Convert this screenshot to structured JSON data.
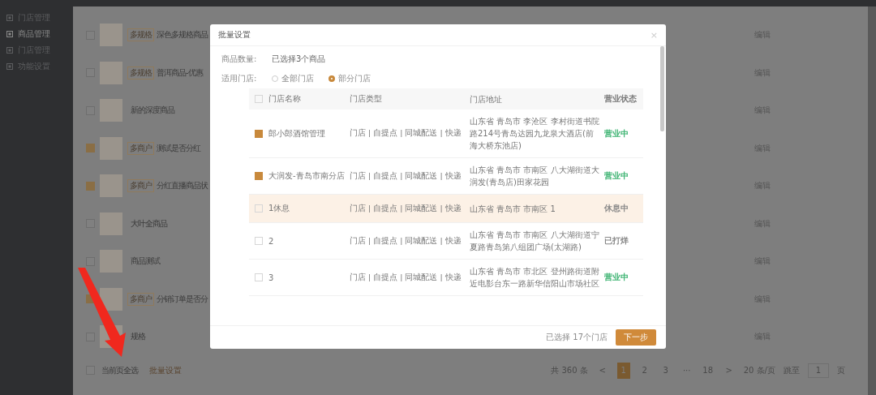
{
  "sidebar": {
    "items": [
      {
        "label": "门店管理",
        "selected": false
      },
      {
        "label": "商品管理",
        "selected": true
      },
      {
        "label": "门店管理",
        "selected": false
      },
      {
        "label": "功能设置",
        "selected": false
      }
    ]
  },
  "products": {
    "rows": [
      {
        "checked": false,
        "tag": "多规格",
        "name": "深色多规格商品",
        "action": "编辑"
      },
      {
        "checked": false,
        "tag": "多规格",
        "name": "普洱商品-优惠",
        "action": "编辑"
      },
      {
        "checked": false,
        "name": "新的深度商品",
        "action": "编辑"
      },
      {
        "checked": true,
        "tag": "多商户",
        "name": "测试是否分红",
        "action": "编辑"
      },
      {
        "checked": true,
        "tag": "多商户",
        "name": "分红直播商品状",
        "action": "编辑"
      },
      {
        "checked": false,
        "name": "大叶全商品",
        "action": "编辑"
      },
      {
        "checked": false,
        "name": "商品测试",
        "action": "编辑"
      },
      {
        "checked": true,
        "tag": "多商户",
        "name": "分销订单是否分",
        "action": "编辑"
      },
      {
        "checked": false,
        "name": "规格",
        "action": "编辑"
      }
    ],
    "select_all": {
      "label": "当前页全选",
      "checked": false
    },
    "batch_link": "批量设置",
    "pagination": {
      "total": "共 360 条",
      "prev": "<",
      "pages": [
        {
          "label": "1",
          "selected": true
        },
        {
          "label": "2",
          "selected": false
        },
        {
          "label": "3",
          "selected": false
        },
        {
          "label": "···",
          "selected": false
        },
        {
          "label": "18",
          "selected": false
        }
      ],
      "next": ">",
      "page_size": "20 条/页",
      "jump_label": "跳至",
      "jump_value": "1",
      "page_unit": "页"
    }
  },
  "modal": {
    "title": "批量设置",
    "close": "×",
    "count_label": "商品数量:",
    "count_value": "已选择3个商品",
    "stores_label": "适用门店:",
    "radios": [
      {
        "label": "全部门店",
        "selected": false
      },
      {
        "label": "部分门店",
        "selected": true
      }
    ],
    "table": {
      "header_checked": false,
      "columns": [
        "门店名称",
        "门店类型",
        "门店地址",
        "营业状态"
      ],
      "rows": [
        {
          "checked": true,
          "highlighted": false,
          "name": "郎小郎酒馆管理",
          "type": "门店 | 自提点 | 同城配送 | 快递",
          "address": "山东省 青岛市 李沧区 李村街道书院路214号青岛达园九龙泉大酒店(前海大桥东池店)",
          "status": "营业中",
          "color": "#3cb371"
        },
        {
          "checked": true,
          "highlighted": false,
          "name": "大润发-青岛市南分店",
          "type": "门店 | 自提点 | 同城配送 | 快递",
          "address": "山东省 青岛市 市南区 八大湖街道大润发(青岛店)田家花园",
          "status": "营业中",
          "color": "#3cb371"
        },
        {
          "checked": false,
          "highlighted": true,
          "name": "1休息",
          "type": "门店 | 自提点 | 同城配送 | 快递",
          "address": "山东省 青岛市 市南区 1",
          "status": "休息中",
          "color": "#888888"
        },
        {
          "checked": false,
          "highlighted": false,
          "name": "2",
          "type": "门店 | 自提点 | 同城配送 | 快递",
          "address": "山东省 青岛市 市南区 八大湖街道宁夏路青岛第八组团广场(太湖路)",
          "status": "已打烊",
          "color": "#888888"
        },
        {
          "checked": false,
          "highlighted": false,
          "name": "3",
          "type": "门店 | 自提点 | 同城配送 | 快递",
          "address": "山东省 青岛市 市北区 登州路街道附近电影台东一路新华信阳山市场社区",
          "status": "营业中",
          "color": "#3cb371"
        }
      ]
    },
    "selected_count": "已选择 17个门店",
    "next_button": "下一步"
  }
}
